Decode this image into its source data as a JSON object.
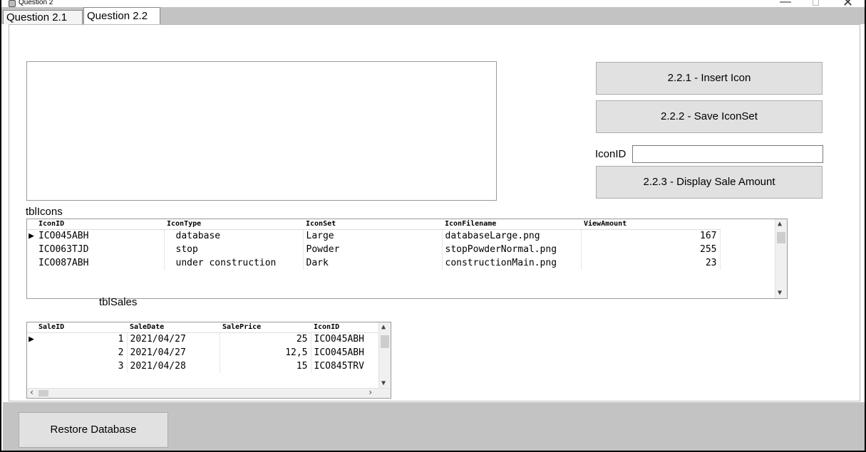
{
  "window": {
    "title": "Question 2",
    "minimize": "—",
    "maximize": "☐",
    "close": "✕"
  },
  "tabs": [
    {
      "label": "Question 2.1"
    },
    {
      "label": "Question 2.2"
    }
  ],
  "buttons": {
    "insert_icon": "2.2.1 - Insert Icon",
    "save_iconset": "2.2.2 - Save IconSet",
    "display_sale_amount": "2.2.3 - Display Sale Amount",
    "restore_database": "Restore Database"
  },
  "iconid_field": {
    "label": "IconID",
    "value": ""
  },
  "tblIcons": {
    "label": "tblIcons",
    "columns": [
      "IconID",
      "IconType",
      "IconSet",
      "IconFilename",
      "ViewAmount"
    ],
    "rows": [
      {
        "marker": "▶",
        "cells": [
          "ICO045ABH",
          "database",
          "Large",
          "databaseLarge.png",
          "167"
        ]
      },
      {
        "marker": "",
        "cells": [
          "ICO063TJD",
          "stop",
          "Powder",
          "stopPowderNormal.png",
          "255"
        ]
      },
      {
        "marker": "",
        "cells": [
          "ICO087ABH",
          "under construction",
          "Dark",
          "constructionMain.png",
          "23"
        ]
      }
    ]
  },
  "tblSales": {
    "label": "tblSales",
    "columns": [
      "SaleID",
      "SaleDate",
      "SalePrice",
      "IconID"
    ],
    "rows": [
      {
        "marker": "▶",
        "cells": [
          "1",
          "2021/04/27",
          "25",
          "ICO045ABH"
        ]
      },
      {
        "marker": "",
        "cells": [
          "2",
          "2021/04/27",
          "12,5",
          "ICO045ABH"
        ]
      },
      {
        "marker": "",
        "cells": [
          "3",
          "2021/04/28",
          "15",
          "ICO845TRV"
        ]
      }
    ]
  }
}
